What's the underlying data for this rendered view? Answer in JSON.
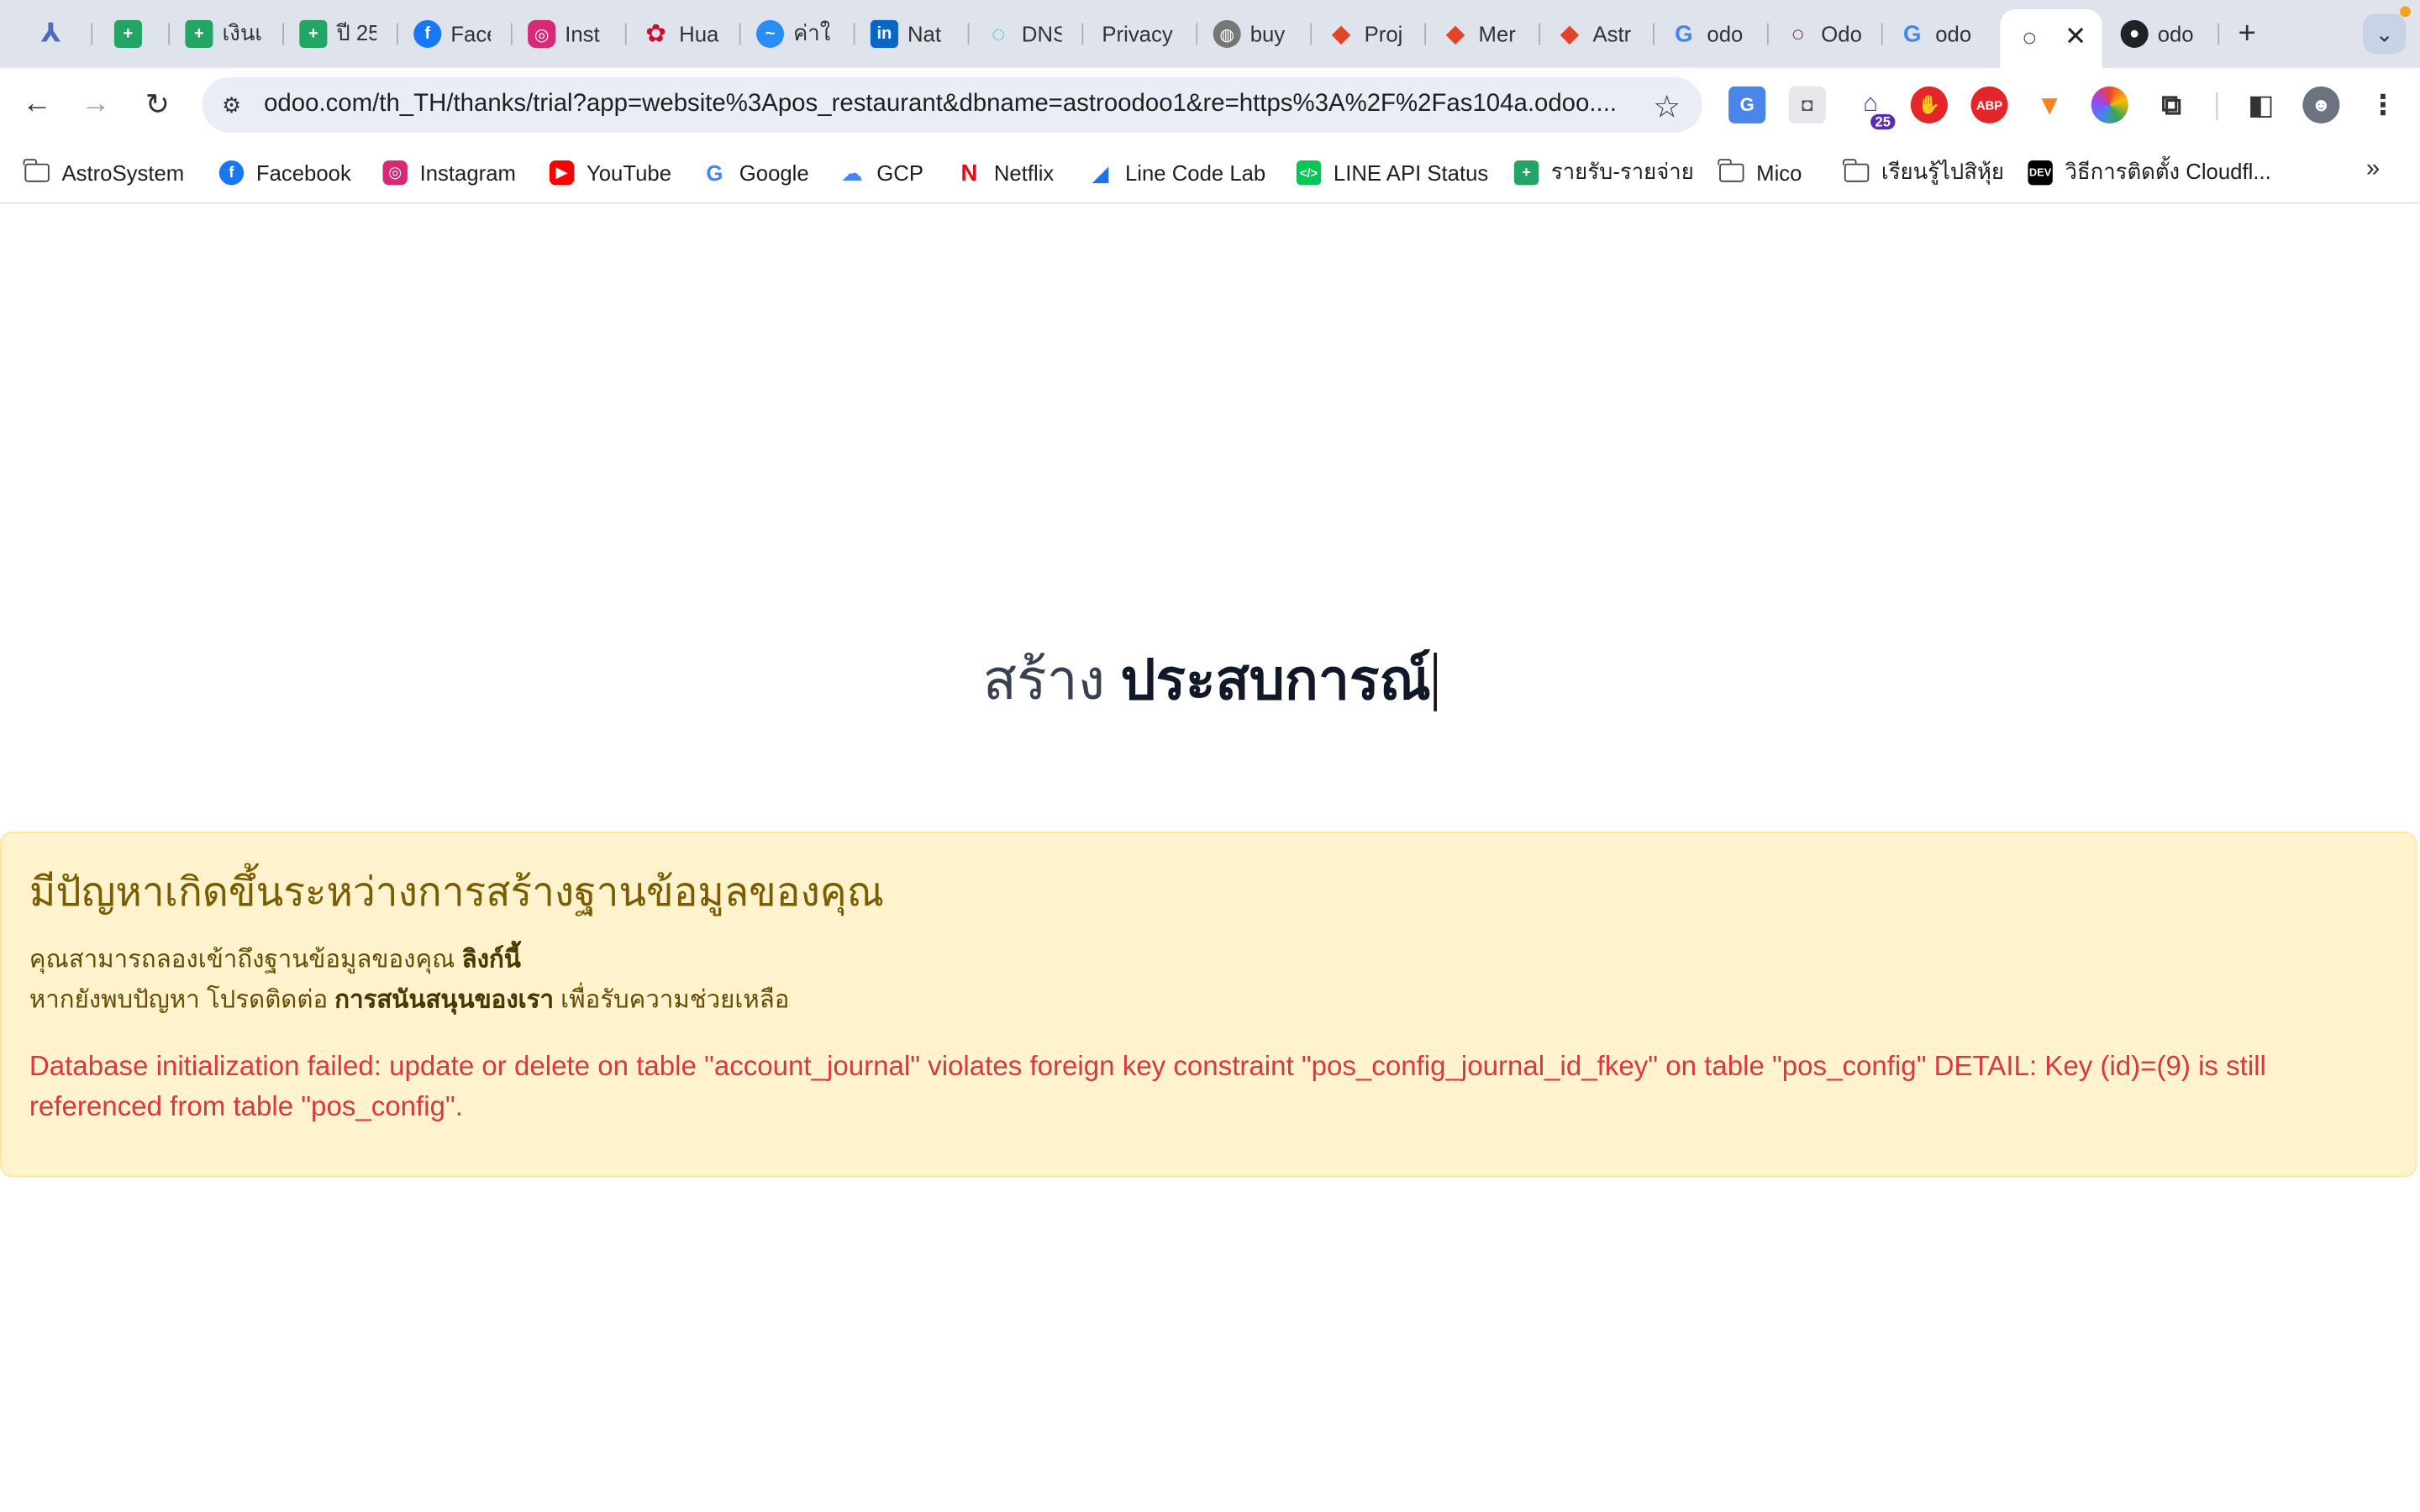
{
  "tabs": [
    {
      "icon": "app-icon",
      "title": "",
      "color": "#4d6bc2"
    },
    {
      "icon": "sheets-icon",
      "title": "",
      "color": "#23a566"
    },
    {
      "icon": "sheets-icon",
      "title": "เงินเ",
      "color": "#23a566"
    },
    {
      "icon": "sheets-icon",
      "title": "ปี 25",
      "color": "#23a566"
    },
    {
      "icon": "facebook-icon",
      "title": "Face",
      "color": "#1877f2"
    },
    {
      "icon": "instagram-icon",
      "title": "Inst",
      "color": "#d62976"
    },
    {
      "icon": "huawei-icon",
      "title": "Hua",
      "color": "#cf0a2c"
    },
    {
      "icon": "messenger-icon",
      "title": "ค่าใ",
      "color": "#2a8cf5"
    },
    {
      "icon": "linkedin-icon",
      "title": "Nat",
      "color": "#0a66c2"
    },
    {
      "icon": "dns-icon",
      "title": "DNS",
      "color": "#27b3c9"
    },
    {
      "icon": "",
      "title": "Privacy",
      "color": ""
    },
    {
      "icon": "globe-icon",
      "title": "buy",
      "color": "#777777"
    },
    {
      "icon": "gitlab-icon",
      "title": "Proj",
      "color": "#e24329"
    },
    {
      "icon": "gitlab-icon",
      "title": "Mer",
      "color": "#e24329"
    },
    {
      "icon": "gitlab-icon",
      "title": "Astr",
      "color": "#e24329"
    },
    {
      "icon": "google-icon",
      "title": "odo",
      "color": "#4285f4"
    },
    {
      "icon": "odoo-icon",
      "title": "Odo",
      "color": "#714b67"
    },
    {
      "icon": "google-icon",
      "title": "odo",
      "color": "#4285f4"
    },
    {
      "icon": "odoo-icon",
      "title": "",
      "color": "#714b67",
      "active": true
    },
    {
      "icon": "github-icon",
      "title": "odo",
      "color": "#1f2328"
    }
  ],
  "toolbar": {
    "url": "odoo.com/th_TH/thanks/trial?app=website%3Apos_restaurant&dbname=astroodoo1&re=https%3A%2F%2Fas104a.odoo....",
    "extension_badge": "25"
  },
  "bookmarks": [
    {
      "label": "AstroSystem",
      "icon": "folder-icon"
    },
    {
      "label": "Facebook",
      "icon": "facebook-icon"
    },
    {
      "label": "Instagram",
      "icon": "instagram-icon"
    },
    {
      "label": "YouTube",
      "icon": "youtube-icon"
    },
    {
      "label": "Google",
      "icon": "google-icon"
    },
    {
      "label": "GCP",
      "icon": "gcp-icon"
    },
    {
      "label": "Netflix",
      "icon": "netflix-icon"
    },
    {
      "label": "Line Code Lab",
      "icon": "codelab-icon"
    },
    {
      "label": "LINE API Status",
      "icon": "line-api-icon"
    },
    {
      "label": "รายรับ-รายจ่าย",
      "icon": "sheets-icon"
    },
    {
      "label": "Mico",
      "icon": "folder-icon"
    },
    {
      "label": "เรียนรู้ไปสิหุ้ย",
      "icon": "folder-icon"
    },
    {
      "label": "วิธีการติดตั้ง Cloudfl...",
      "icon": "dev-icon"
    }
  ],
  "page": {
    "heading_light": "สร้าง",
    "heading_bold": "ประสบการณ์",
    "alert": {
      "title": "มีปัญหาเกิดขึ้นระหว่างการสร้างฐานข้อมูลของคุณ",
      "line1_text": "คุณสามารถลองเข้าถึงฐานข้อมูลของคุณ",
      "line1_link": "ลิงก์นี้",
      "line2_text": "หากยังพบปัญหา โปรดติดต่อ",
      "line2_link": "การสนันสนุนของเรา",
      "line2_suffix": "เพื่อรับความช่วยเหลือ",
      "error": "Database initialization failed: update or delete on table \"account_journal\" violates foreign key constraint \"pos_config_journal_id_fkey\" on table \"pos_config\" DETAIL: Key (id)=(9) is still referenced from table \"pos_config\"."
    }
  }
}
